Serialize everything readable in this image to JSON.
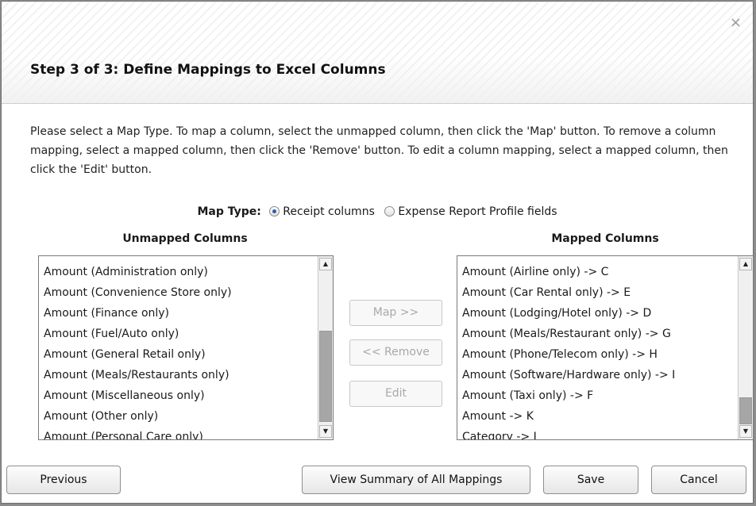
{
  "dialog": {
    "title": "Step 3 of 3: Define Mappings to Excel Columns",
    "close_glyph": "×",
    "instructions": "Please select a Map Type. To map a column, select the unmapped column, then click the 'Map' button. To remove a column mapping, select a mapped column, then click the 'Remove' button. To edit a column mapping, select a mapped column, then click the 'Edit' button."
  },
  "map_type": {
    "label": "Map Type:",
    "options": [
      {
        "label": "Receipt columns",
        "selected": true
      },
      {
        "label": "Expense Report Profile fields",
        "selected": false
      }
    ]
  },
  "unmapped": {
    "header": "Unmapped Columns",
    "items": [
      "Amount (Administration only)",
      "Amount (Convenience Store only)",
      "Amount (Finance only)",
      "Amount (Fuel/Auto only)",
      "Amount (General Retail only)",
      "Amount (Meals/Restaurants only)",
      "Amount (Miscellaneous only)",
      "Amount (Other only)",
      "Amount (Personal Care only)"
    ]
  },
  "mapped": {
    "header": "Mapped Columns",
    "items": [
      "Amount (Airline only) -> C",
      "Amount (Car Rental only) -> E",
      "Amount (Lodging/Hotel only) -> D",
      "Amount (Meals/Restaurant only) -> G",
      "Amount (Phone/Telecom only) -> H",
      "Amount (Software/Hardware only) -> I",
      "Amount (Taxi only) -> F",
      "Amount -> K",
      "Category -> J"
    ]
  },
  "actions": {
    "map": "Map >>",
    "remove": "<< Remove",
    "edit": "Edit"
  },
  "footer": {
    "previous": "Previous",
    "summary": "View Summary of All Mappings",
    "save": "Save",
    "cancel": "Cancel"
  },
  "colors": {
    "accent_radio": "#2a5fb0",
    "disabled_text": "#a9a9a9",
    "scroll_thumb": "#a6a6a6"
  },
  "icons": {
    "close": "close-icon",
    "scroll_up": "scroll-up-arrow-icon",
    "scroll_down": "scroll-down-arrow-icon"
  }
}
